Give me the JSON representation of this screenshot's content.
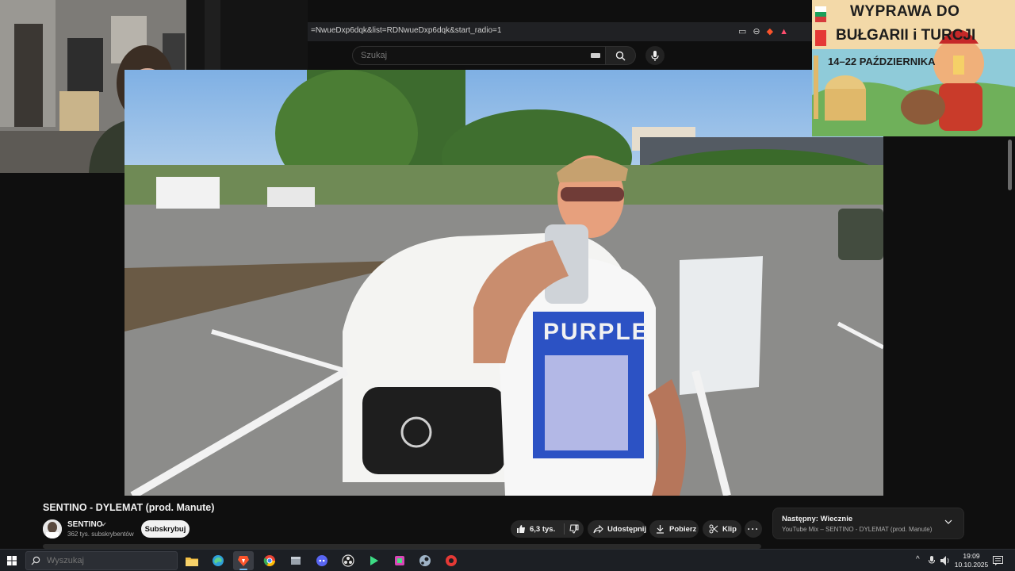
{
  "browser": {
    "url_fragment": "=NwueDxp6dqk&list=RDNwueDxp6dqk&start_radio=1"
  },
  "youtube": {
    "search_placeholder": "Szukaj",
    "video": {
      "title": "SENTINO - DYLEMAT (prod. Manute)"
    },
    "channel": {
      "name": "SENTINO",
      "subscribers": "362 tys. subskrybentów",
      "subscribe_label": "Subskrybuj"
    },
    "actions": {
      "like_count": "6,3 tys.",
      "share_label": "Udostępnij",
      "download_label": "Pobierz",
      "clip_label": "Klip"
    },
    "next_up": {
      "label": "Następny: Wiecznie",
      "subtitle": "YouTube Mix – SENTINO - DYLEMAT (prod. Manute)"
    }
  },
  "ad": {
    "line1": "WYPRAWA DO",
    "line2": "BUŁGARII i TURCJI",
    "dates": "14–22 PAŹDZIERNIKA"
  },
  "taskbar": {
    "search_placeholder": "Wyszukaj",
    "apps": [
      {
        "name": "file-explorer",
        "color": "#f4c145"
      },
      {
        "name": "edge",
        "color": "#2fa0d8"
      },
      {
        "name": "brave",
        "color": "#fb542b"
      },
      {
        "name": "chrome",
        "color": "#34a853"
      },
      {
        "name": "installer",
        "color": "#9aa3ad"
      },
      {
        "name": "discord",
        "color": "#8d6ef5"
      },
      {
        "name": "obs",
        "color": "#e0e0e0"
      },
      {
        "name": "media-player",
        "color": "#3ddc84"
      },
      {
        "name": "app-pink",
        "color": "#d946b7"
      },
      {
        "name": "steam-like",
        "color": "#9fb4c7"
      },
      {
        "name": "recorder",
        "color": "#e53935"
      }
    ],
    "time": "19:09",
    "date": "10.10.2025"
  }
}
